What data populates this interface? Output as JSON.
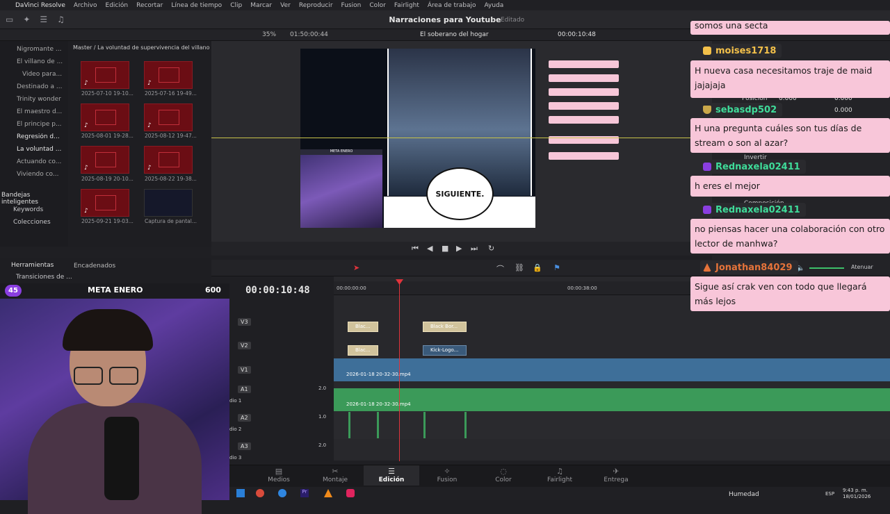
{
  "menubar": {
    "app": "DaVinci Resolve",
    "items": [
      "Archivo",
      "Edición",
      "Recortar",
      "Línea de tiempo",
      "Clip",
      "Marcar",
      "Ver",
      "Reproducir",
      "Fusion",
      "Color",
      "Fairlight",
      "Área de trabajo",
      "Ayuda"
    ]
  },
  "project": {
    "title": "Narraciones para Youtube",
    "status": "Editado"
  },
  "subbar": {
    "zoom": "35%",
    "duration": "01:50:00:44",
    "timeline_name": "El soberano del hogar",
    "timecode": "00:00:10:48"
  },
  "tree": {
    "items": [
      "Nigromante ...",
      "El villano de ...",
      "Video para...",
      "Destinado a ...",
      "Trinity wonder",
      "El maestro d...",
      "El principe p...",
      "Regresión d...",
      "La voluntad ...",
      "Actuando co...",
      "Viviendo co..."
    ],
    "smart_bins": "Bandejas inteligentes",
    "keywords": "Keywords",
    "collections": "Colecciones"
  },
  "media_pool": {
    "path": "Master / La voluntad de supervivencia del villano",
    "clips": [
      "2025-07-10 19-10...",
      "2025-07-16 19-49...",
      "2025-08-01 19-28...",
      "2025-08-12 19-47...",
      "2025-08-19 20-10...",
      "2025-08-22 19-38...",
      "2025-09-21 19-03...",
      "Captura de pantal..."
    ]
  },
  "tools": {
    "herramientas": "Herramientas",
    "transiciones": "Transiciones de ...",
    "encadenados": "Encadenados"
  },
  "viewer": {
    "bubble_text": "SIGUIENTE.",
    "cam_label": "META ENERO"
  },
  "inspector": {
    "posicion": "Posición",
    "x": "0.000",
    "y": "0.000",
    "y2": "0.000",
    "invertir": "Invertir",
    "composicion": "Composición"
  },
  "timeline": {
    "timecode": "00:00:10:48",
    "ruler_marks": [
      "00:00:00:00",
      "00:00:38:00"
    ],
    "tracks": [
      {
        "id": "V3"
      },
      {
        "id": "V2"
      },
      {
        "id": "V1"
      },
      {
        "id": "A1",
        "level": "2.0",
        "name": "dio 1"
      },
      {
        "id": "A2",
        "level": "1.0",
        "name": "dio 2"
      },
      {
        "id": "A3",
        "level": "2.0",
        "name": "dio 3"
      }
    ],
    "clips": {
      "v3a": "Blac...",
      "v3b": "Black Bor...",
      "v2a": "Blac...",
      "v2b": "Kick-Logo...",
      "v1": "2026-01-18 20-32-30.mp4",
      "a1": "2026-01-18 20-32-30.mp4"
    },
    "attenuate": "Atenuar"
  },
  "pages": [
    "Medios",
    "Montaje",
    "Edición",
    "Fusion",
    "Color",
    "Fairlight",
    "Entrega"
  ],
  "active_page": "Edición",
  "taskbar": {
    "weather": "Humedad",
    "lang": "ESP",
    "time": "9:43 p. m.",
    "date": "18/01/2026"
  },
  "stream_goal": {
    "count": "45",
    "label": "META ENERO",
    "value": "600"
  },
  "chat": {
    "top_partial": "somos una secta",
    "messages": [
      {
        "user": "moises1718",
        "text": "H nueva casa necesitamos traje de maid jajajaja",
        "color": "#f3c04a"
      },
      {
        "user": "sebasdp502",
        "text": "H una pregunta cuáles son tus días de stream o son al azar?",
        "color": "#3fdc9a"
      },
      {
        "user": "Rednaxela02411",
        "text": "h eres el mejor",
        "color": "#3fdc9a"
      },
      {
        "user": "Rednaxela02411",
        "text": "no piensas hacer una colaboración con otro lector de manhwa?",
        "color": "#3fdc9a"
      },
      {
        "user": "Jonathan84029",
        "text": "Sigue así crak ven con todo que llegará más lejos",
        "color": "#e5733a"
      }
    ]
  },
  "colors": {
    "playhead": "#e0343c",
    "v1": "#3e6f99",
    "a1": "#3b9a59",
    "chat_bg": "#f8c6d9",
    "accent": "#8a3ee0"
  }
}
